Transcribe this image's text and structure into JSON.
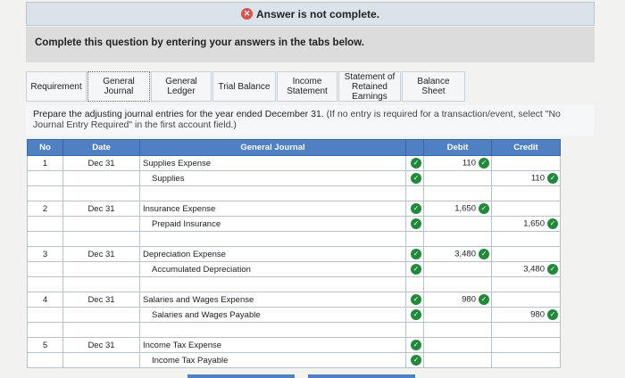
{
  "banner": {
    "icon": "x-circle-icon",
    "text": "Answer is not complete."
  },
  "question": {
    "text": "Complete this question by entering your answers in the tabs below."
  },
  "tabs": [
    {
      "lines": [
        "Requirement"
      ]
    },
    {
      "lines": [
        "General",
        "Journal"
      ]
    },
    {
      "lines": [
        "General",
        "Ledger"
      ]
    },
    {
      "lines": [
        "Trial Balance"
      ]
    },
    {
      "lines": [
        "Income",
        "Statement"
      ]
    },
    {
      "lines": [
        "Statement of",
        "Retained",
        "Earnings"
      ]
    },
    {
      "lines": [
        "Balance Sheet"
      ]
    }
  ],
  "instructions": {
    "main": "Prepare the adjusting journal entries for the year ended December 31.",
    "note": "(If no entry is required for a transaction/event, select \"No Journal Entry Required\" in the first account field.)"
  },
  "journal": {
    "headers": {
      "no": "No",
      "date": "Date",
      "account": "General Journal",
      "debit": "Debit",
      "credit": "Credit"
    },
    "entries": [
      {
        "no": "1",
        "date": "Dec 31",
        "debit_account": "Supplies Expense",
        "credit_account": "Supplies",
        "debit": "110",
        "credit": "110"
      },
      {
        "no": "2",
        "date": "Dec 31",
        "debit_account": "Insurance Expense",
        "credit_account": "Prepaid Insurance",
        "debit": "1,650",
        "credit": "1,650"
      },
      {
        "no": "3",
        "date": "Dec 31",
        "debit_account": "Depreciation Expense",
        "credit_account": "Accumulated Depreciation",
        "debit": "3,480",
        "credit": "3,480"
      },
      {
        "no": "4",
        "date": "Dec 31",
        "debit_account": "Salaries and Wages Expense",
        "credit_account": "Salaries and Wages Payable",
        "debit": "980",
        "credit": "980"
      },
      {
        "no": "5",
        "date": "Dec 31",
        "debit_account": "Income Tax Expense",
        "credit_account": "Income Tax Payable",
        "debit": "",
        "credit": ""
      }
    ]
  },
  "colors": {
    "header_blue": "#4f80c1",
    "check_green": "#1f8a3a",
    "error_red": "#d9534f"
  }
}
